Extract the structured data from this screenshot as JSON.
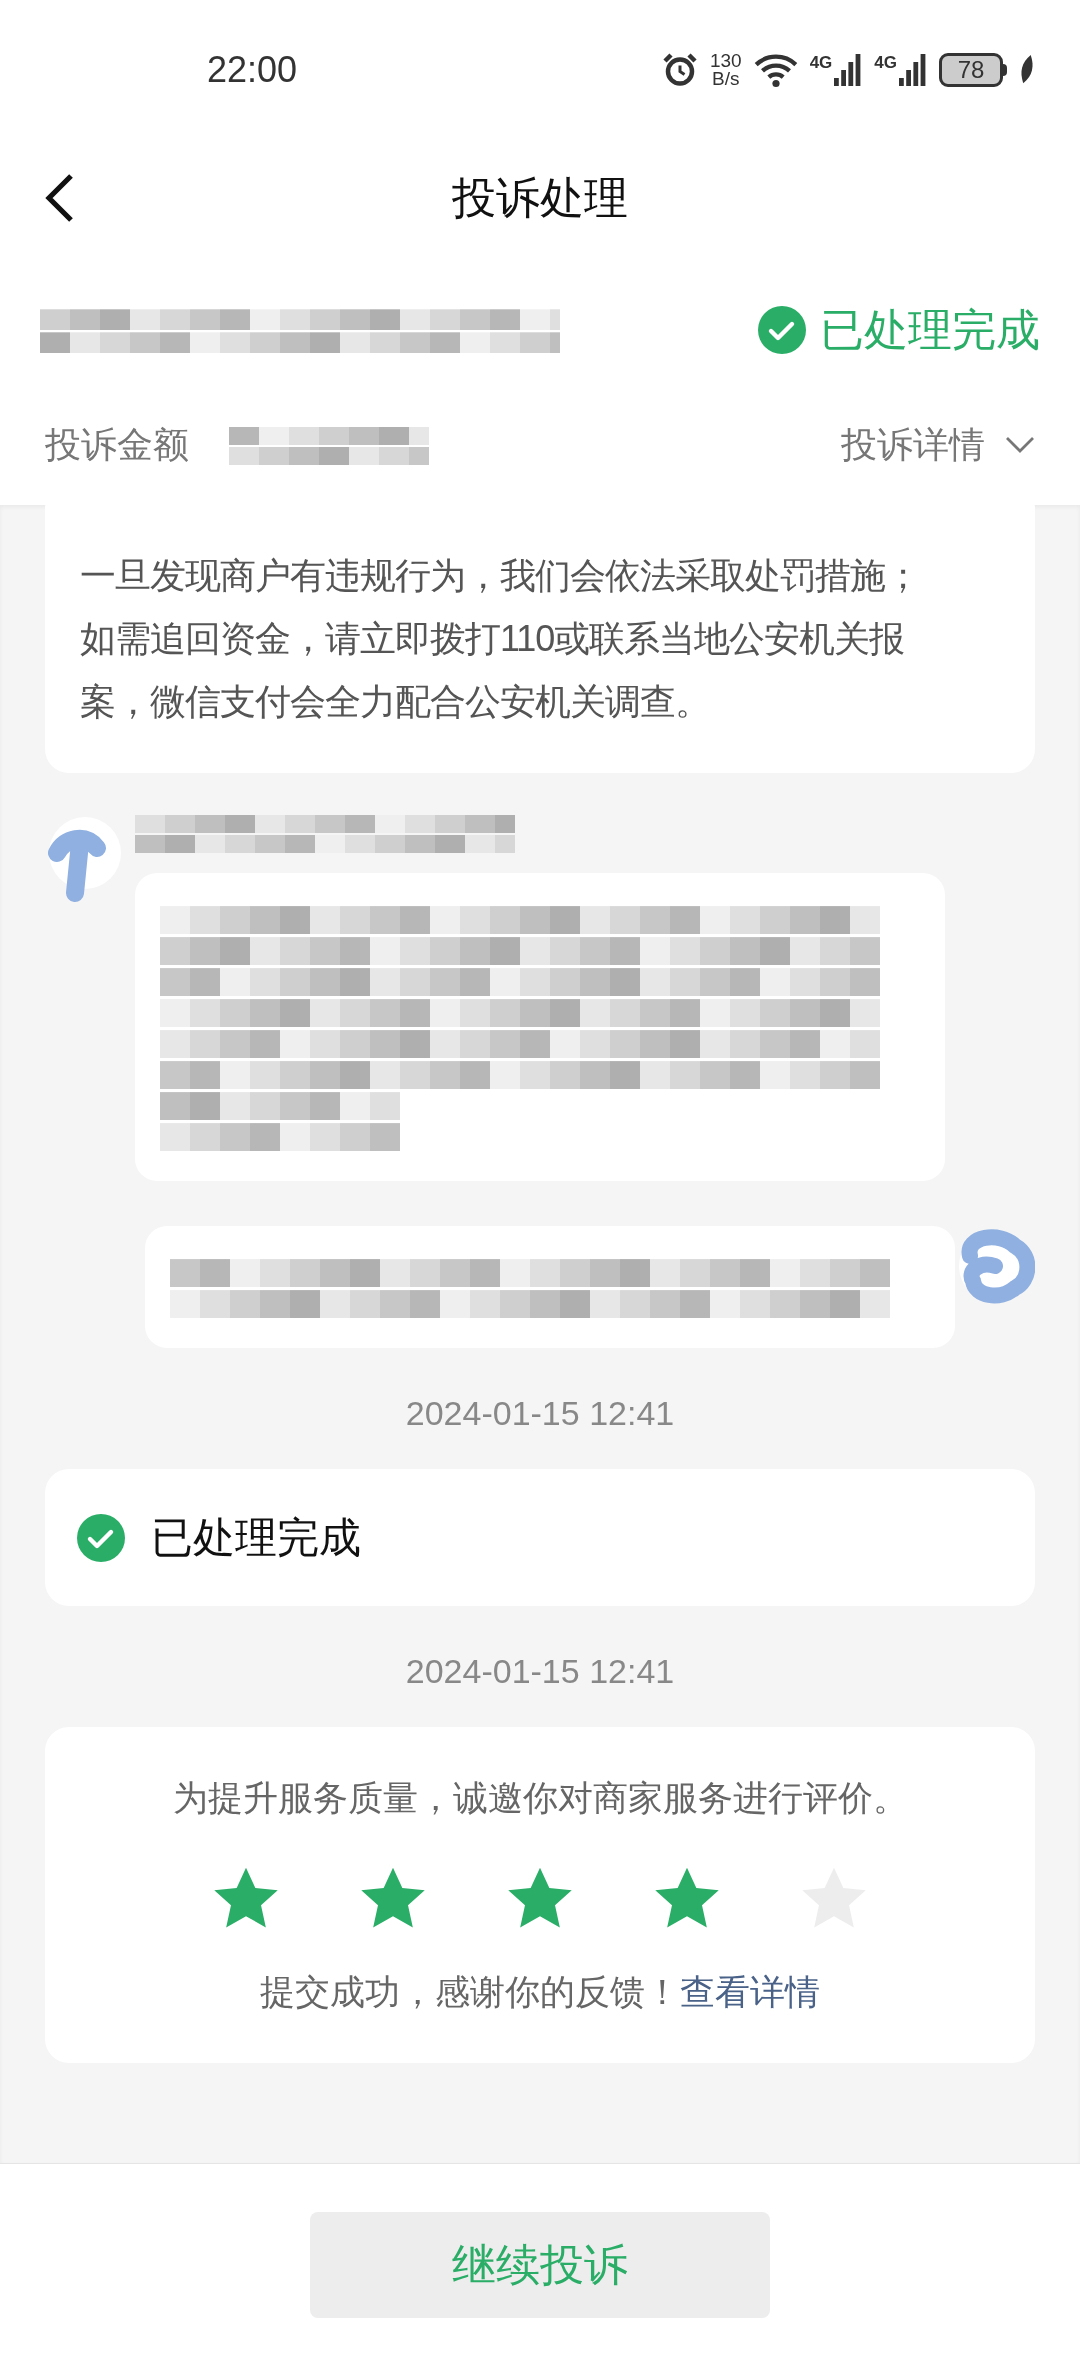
{
  "status_bar": {
    "time": "22:00",
    "net_speed_value": "130",
    "net_speed_unit": "B/s",
    "signal_1": "4G",
    "signal_2": "4G",
    "battery": "78"
  },
  "header": {
    "title": "投诉处理"
  },
  "summary": {
    "status": "已处理完成",
    "amount_label": "投诉金额",
    "details_link": "投诉详情"
  },
  "system_message": [
    "一旦发现商户有违规行为，我们会依法采取处罚措施；",
    "如需追回资金，请立即拨打110或联系当地公安机关报",
    "案，微信支付会全力配合公安机关调查。"
  ],
  "chat": [
    {
      "kind": "incoming"
    },
    {
      "kind": "outgoing"
    }
  ],
  "timeline": [
    {
      "date": "2024-01-15 12:41",
      "kind": "status",
      "text": "已处理完成"
    },
    {
      "date": "2024-01-15 12:41",
      "kind": "rating",
      "prompt": "为提升服务质量，诚邀你对商家服务进行评价。",
      "stars": 4,
      "thanks": "提交成功，感谢你的反馈！",
      "link": "查看详情"
    }
  ],
  "footer": {
    "button": "继续投诉"
  }
}
